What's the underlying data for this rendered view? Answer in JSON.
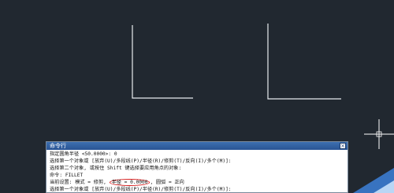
{
  "command_window": {
    "title": "命令行",
    "close_glyph": "×",
    "lines": [
      "指定圆角半径 <50.0000>: 0",
      "选择第一个对象或 [放弃(U)/多段线(P)/半径(R)/修剪(T)/反向(I)/多个(M)]:",
      "选择第二个对象, 或按住 Shift 键选择要应用角点的对象:",
      "命令: FILLET",
      "当前设置: 模式 = 修剪, ",
      "选择第一个对象或 [放弃(U)/多段线(P)/半径(R)/修剪(T)/反向(I)/多个(M)]:"
    ],
    "settings_radius": "半径 = 0.0000",
    "settings_tail": ", 圆弧 = 正向"
  },
  "colors": {
    "background": "#212830",
    "geometry": "#e8ecef",
    "crosshair": "#ffffff",
    "highlight_circle": "#d82020"
  },
  "icons": {
    "crosshair": "crosshair-cursor-icon",
    "close": "close-icon"
  }
}
